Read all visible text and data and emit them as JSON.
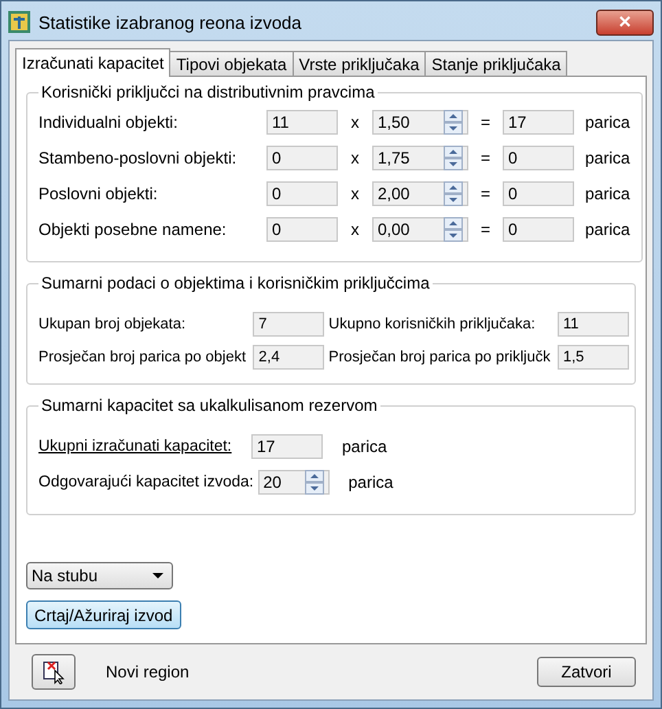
{
  "window": {
    "title": "Statistike izabranog reona izvoda",
    "close": "✕"
  },
  "tabs": [
    {
      "label": "Izračunati kapacitet",
      "selected": true
    },
    {
      "label": "Tipovi objekata",
      "selected": false
    },
    {
      "label": "Vrste priključaka",
      "selected": false
    },
    {
      "label": "Stanje priključaka",
      "selected": false
    }
  ],
  "connections": {
    "title": "Korisnički priključci na distributivnim pravcima",
    "rows": [
      {
        "label": "Individualni objekti:",
        "count": "11",
        "times": "x",
        "factor": "1,50",
        "equals": "=",
        "result": "17",
        "unit": "parica"
      },
      {
        "label": "Stambeno-poslovni objekti:",
        "count": "0",
        "times": "x",
        "factor": "1,75",
        "equals": "=",
        "result": "0",
        "unit": "parica"
      },
      {
        "label": "Poslovni objekti:",
        "count": "0",
        "times": "x",
        "factor": "2,00",
        "equals": "=",
        "result": "0",
        "unit": "parica"
      },
      {
        "label": "Objekti posebne namene:",
        "count": "0",
        "times": "x",
        "factor": "0,00",
        "equals": "=",
        "result": "0",
        "unit": "parica"
      }
    ]
  },
  "summary": {
    "title": "Sumarni podaci o objektima i korisničkim priključcima",
    "items": [
      {
        "label": "Ukupan broj objekata:",
        "value": "7"
      },
      {
        "label": "Ukupno korisničkih priključaka:",
        "value": "11"
      },
      {
        "label": "Prosječan broj parica po objekt",
        "value": "2,4"
      },
      {
        "label": "Prosječan broj parica po priključk",
        "value": "1,5"
      }
    ]
  },
  "capacity": {
    "title": "Sumarni kapacitet sa ukalkulisanom rezervom",
    "rows": [
      {
        "kind": "plain",
        "label": "Ukupni izračunati kapacitet:",
        "underlined": true,
        "value": "17",
        "unit": "parica"
      },
      {
        "kind": "spin",
        "label": "Odgovarajući kapacitet izvoda:",
        "underlined": false,
        "value": "20",
        "unit": "parica"
      }
    ]
  },
  "dropdown": {
    "value": "Na stubu"
  },
  "draw_button": "Crtaj/Ažuriraj izvod",
  "new_region": "Novi region",
  "close_button": "Zatvori"
}
